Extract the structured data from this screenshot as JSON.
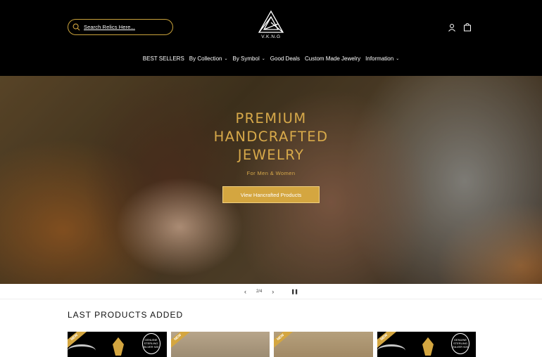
{
  "header": {
    "search_placeholder": "Search Relics Here...",
    "logo_text": "V.K.N.G"
  },
  "nav": {
    "items": [
      {
        "label": "BEST SELLERS",
        "chevron": false
      },
      {
        "label": "By Collection",
        "chevron": true
      },
      {
        "label": "By Symbol",
        "chevron": true
      },
      {
        "label": "Good Deals",
        "chevron": false
      },
      {
        "label": "Custom Made Jewelry",
        "chevron": false
      },
      {
        "label": "Information",
        "chevron": true
      }
    ]
  },
  "hero": {
    "title_line1": "PREMIUM",
    "title_line2": "HANDCRAFTED",
    "title_line3": "JEWELRY",
    "subtitle": "For Men & Women",
    "button_label": "View Hancrafted Products"
  },
  "slider": {
    "counter": "2/4"
  },
  "products": {
    "section_title": "LAST PRODUCTS ADDED",
    "badge": "NEW",
    "seal_text": "GENUINE STERLING SILVER 925"
  },
  "colors": {
    "accent": "#d4a640",
    "header_bg": "#000000"
  }
}
